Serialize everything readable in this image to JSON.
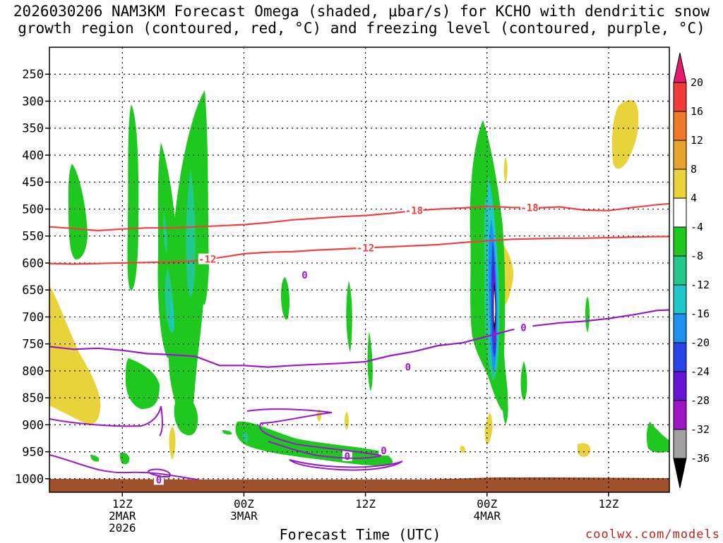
{
  "title_line1": "2026030206 NAM3KM Forecast Omega (shaded, μbar/s) for KCHO with dendritic snow",
  "title_line2": "growth region (contoured, red, °C) and freezing level (contoured, purple, °C)",
  "xlabel": "Forecast Time (UTC)",
  "credit": "coolwx.com/models",
  "chart_data": {
    "type": "heatmap",
    "station": "KCHO",
    "model": "NAM3KM",
    "init": "2026030206",
    "y_axis": {
      "ticks": [
        250,
        300,
        350,
        400,
        450,
        500,
        550,
        600,
        650,
        700,
        750,
        800,
        850,
        900,
        950,
        1000
      ],
      "range_hpa": [
        200,
        1025
      ]
    },
    "x_axis": {
      "range_hours": [
        6,
        57
      ],
      "ticks": [
        {
          "hour": 12,
          "lines": [
            "12Z",
            "2MAR",
            "2026"
          ]
        },
        {
          "hour": 22,
          "lines": [
            "00Z",
            "3MAR"
          ]
        },
        {
          "hour": 32,
          "lines": [
            "12Z"
          ]
        },
        {
          "hour": 42,
          "lines": [
            "00Z",
            "4MAR"
          ]
        },
        {
          "hour": 52,
          "lines": [
            "12Z"
          ]
        }
      ]
    },
    "colorbar": {
      "labels": [
        20,
        16,
        12,
        8,
        4,
        -4,
        -8,
        -12,
        -16,
        -20,
        -24,
        -28,
        -32,
        -36
      ],
      "bands": [
        {
          "range": [
            16,
            20
          ],
          "color": "#f23c3c"
        },
        {
          "range": [
            12,
            16
          ],
          "color": "#f07a2a"
        },
        {
          "range": [
            8,
            12
          ],
          "color": "#e8a42a"
        },
        {
          "range": [
            4,
            8
          ],
          "color": "#e8d43a"
        },
        {
          "range": [
            -4,
            4
          ],
          "color": "#ffffff"
        },
        {
          "range": [
            -8,
            -4
          ],
          "color": "#1ec81e"
        },
        {
          "range": [
            -12,
            -8
          ],
          "color": "#22c88c"
        },
        {
          "range": [
            -16,
            -12
          ],
          "color": "#1ec8c8"
        },
        {
          "range": [
            -20,
            -16
          ],
          "color": "#1e90f0"
        },
        {
          "range": [
            -24,
            -20
          ],
          "color": "#2846e6"
        },
        {
          "range": [
            -28,
            -24
          ],
          "color": "#6414d2"
        },
        {
          "range": [
            -32,
            -28
          ],
          "color": "#a014c8"
        },
        {
          "range": [
            -36,
            -32
          ],
          "color": "#a0a0a0"
        }
      ],
      "top_overflow_color": "#e6196e",
      "bottom_overflow_color": "#000000"
    },
    "contours": {
      "dgz_minus12": {
        "label": "-12",
        "color": "#f04040",
        "points": [
          [
            6,
            601
          ],
          [
            8,
            602
          ],
          [
            10,
            601
          ],
          [
            12,
            600
          ],
          [
            14,
            599
          ],
          [
            16,
            598
          ],
          [
            18,
            596
          ],
          [
            20,
            590
          ],
          [
            22,
            583
          ],
          [
            24,
            580
          ],
          [
            26,
            579
          ],
          [
            28,
            576
          ],
          [
            30,
            574
          ],
          [
            32,
            572
          ],
          [
            34,
            570
          ],
          [
            36,
            568
          ],
          [
            38,
            566
          ],
          [
            40,
            562
          ],
          [
            42,
            559
          ],
          [
            44,
            556
          ],
          [
            46,
            555
          ],
          [
            48,
            554
          ],
          [
            50,
            554
          ],
          [
            52,
            553
          ],
          [
            54,
            552
          ],
          [
            56,
            551
          ],
          [
            57,
            551
          ]
        ]
      },
      "dgz_minus18": {
        "label": "-18",
        "color": "#f04040",
        "points": [
          [
            6,
            533
          ],
          [
            8,
            536
          ],
          [
            10,
            540
          ],
          [
            12,
            537
          ],
          [
            14,
            535
          ],
          [
            16,
            535
          ],
          [
            18,
            533
          ],
          [
            20,
            531
          ],
          [
            22,
            529
          ],
          [
            24,
            525
          ],
          [
            26,
            520
          ],
          [
            28,
            517
          ],
          [
            30,
            514
          ],
          [
            32,
            512
          ],
          [
            34,
            508
          ],
          [
            36,
            503
          ],
          [
            38,
            500
          ],
          [
            40,
            498
          ],
          [
            42,
            495
          ],
          [
            44,
            497
          ],
          [
            46,
            498
          ],
          [
            48,
            496
          ],
          [
            50,
            502
          ],
          [
            52,
            503
          ],
          [
            54,
            497
          ],
          [
            56,
            492
          ],
          [
            57,
            490
          ]
        ]
      },
      "freezing_level": {
        "label": "0",
        "color": "#9a18c8",
        "points": [
          [
            6,
            755
          ],
          [
            8,
            760
          ],
          [
            10,
            758
          ],
          [
            12,
            762
          ],
          [
            14,
            768
          ],
          [
            16,
            770
          ],
          [
            18,
            773
          ],
          [
            20,
            790
          ],
          [
            22,
            790
          ],
          [
            24,
            793
          ],
          [
            26,
            790
          ],
          [
            28,
            788
          ],
          [
            30,
            786
          ],
          [
            32,
            783
          ],
          [
            34,
            772
          ],
          [
            36,
            764
          ],
          [
            38,
            753
          ],
          [
            40,
            748
          ],
          [
            42,
            736
          ],
          [
            44,
            724
          ],
          [
            46,
            716
          ],
          [
            48,
            711
          ],
          [
            50,
            708
          ],
          [
            52,
            703
          ],
          [
            54,
            696
          ],
          [
            56,
            688
          ],
          [
            57,
            687
          ]
        ]
      }
    }
  }
}
